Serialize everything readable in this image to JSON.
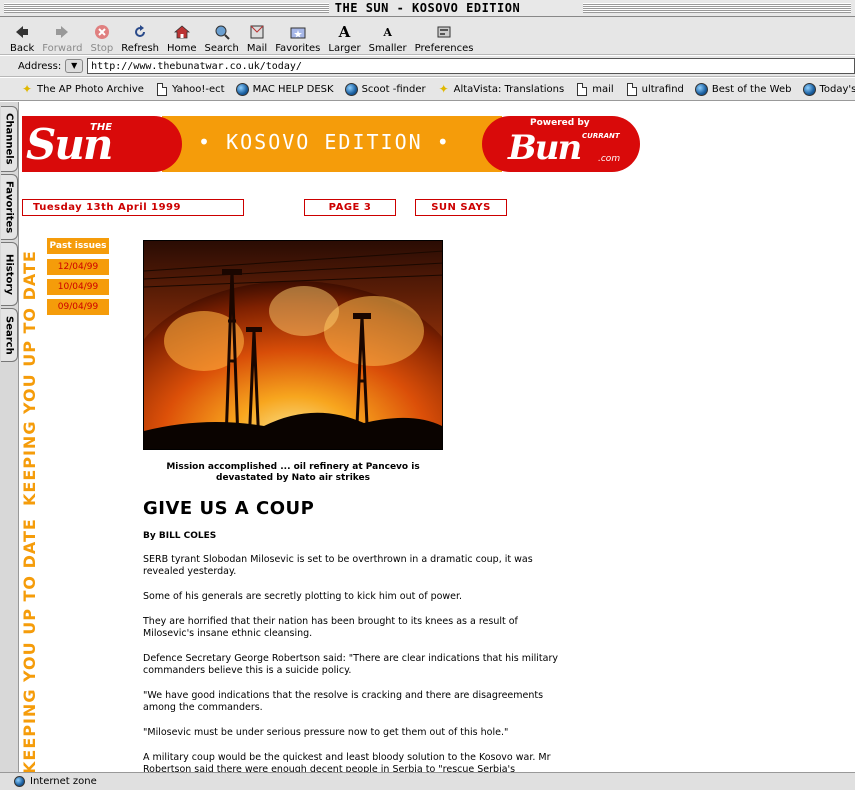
{
  "window": {
    "title": "THE SUN - KOSOVO EDITION"
  },
  "toolbar": {
    "back": "Back",
    "forward": "Forward",
    "stop": "Stop",
    "refresh": "Refresh",
    "home": "Home",
    "search": "Search",
    "mail": "Mail",
    "favorites": "Favorites",
    "larger": "Larger",
    "smaller": "Smaller",
    "preferences": "Preferences"
  },
  "address": {
    "label": "Address:",
    "url": "http://www.thebunatwar.co.uk/today/"
  },
  "favorites_bar": [
    "The AP Photo Archive",
    "Yahoo!-ect",
    "MAC HELP DESK",
    "Scoot -finder",
    "AltaVista: Translations",
    "mail",
    "ultrafind",
    "Best of the Web",
    "Today's Links"
  ],
  "side_tabs": [
    "Channels",
    "Favorites",
    "History",
    "Search"
  ],
  "banner": {
    "the": "THE",
    "sun": "Sun",
    "edition": "• KOSOVO EDITION •",
    "powered": "Powered by",
    "current": "CURRANT",
    "bun": "Bun",
    "dotcom": ".com"
  },
  "nav": {
    "date": "Tuesday 13th April 1999",
    "page3": "PAGE 3",
    "sun_says": "SUN SAYS"
  },
  "side_slogan": {
    "text1": "KEEPING YOU UP TO DATE",
    "text2": "KEEPING YOU UP TO DATE"
  },
  "past_issues": {
    "title": "Past issues",
    "items": [
      "12/04/99",
      "10/04/99",
      "09/04/99"
    ]
  },
  "article": {
    "caption": "Mission accomplished ... oil refinery at Pancevo is devastated by Nato air strikes",
    "headline": "GIVE US A COUP",
    "byline": "By BILL COLES",
    "paragraphs": [
      "SERB tyrant Slobodan Milosevic is set to be overthrown in a dramatic coup, it was revealed yesterday.",
      "Some of his generals are secretly plotting to kick him out of power.",
      "They are horrified that their nation has been brought to its knees as a result of Milosevic's insane ethnic cleansing.",
      "Defence Secretary George Robertson said: \"There are clear indications that his military commanders believe this is a suicide policy.",
      "\"We have good indications that the resolve is cracking and there are disagreements among the commanders.",
      "\"Milosevic must be under serious pressure now to get them out of this hole.\"",
      "A military coup would be the quickest and least bloody solution to the Kosovo war. Mr Robertson said there were enough decent people in Serbia to \"rescue Serbia's"
    ]
  },
  "status": {
    "zone": "Internet zone"
  },
  "colors": {
    "sun_red": "#d90a0a",
    "sun_orange": "#f59c0a",
    "link_red": "#cc0000"
  }
}
